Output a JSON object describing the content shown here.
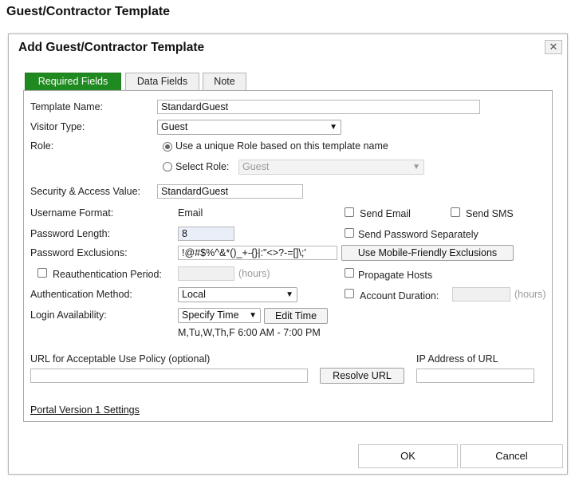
{
  "page": {
    "title": "Guest/Contractor Template"
  },
  "dialog": {
    "title": "Add Guest/Contractor Template",
    "close_glyph": "✕"
  },
  "tabs": [
    {
      "label": "Required Fields",
      "active": true
    },
    {
      "label": "Data Fields",
      "active": false
    },
    {
      "label": "Note",
      "active": false
    }
  ],
  "form": {
    "template_name": {
      "label": "Template Name:",
      "value": "StandardGuest"
    },
    "visitor_type": {
      "label": "Visitor Type:",
      "value": "Guest"
    },
    "role": {
      "label": "Role:",
      "option_unique": "Use a unique Role based on this template name",
      "option_select": "Select Role:",
      "select_value": "Guest",
      "selected": "unique"
    },
    "security_access": {
      "label": "Security & Access Value:",
      "value": "StandardGuest"
    },
    "username_format": {
      "label": "Username Format:",
      "value": "Email"
    },
    "password_length": {
      "label": "Password Length:",
      "value": "8"
    },
    "password_exclusions": {
      "label": "Password Exclusions:",
      "value": "!@#$%^&*()_+-{}|:\"<>?-=[]\\;'"
    },
    "reauthentication": {
      "label": "Reauthentication Period:",
      "value": "",
      "unit": "(hours)",
      "checked": false
    },
    "auth_method": {
      "label": "Authentication Method:",
      "value": "Local"
    },
    "login_availability": {
      "label": "Login Availability:",
      "value": "Specify Time",
      "edit_label": "Edit Time",
      "schedule": "M,Tu,W,Th,F 6:00 AM - 7:00 PM"
    },
    "send_email": {
      "label": "Send Email",
      "checked": false
    },
    "send_sms": {
      "label": "Send SMS",
      "checked": false
    },
    "send_password_separately": {
      "label": "Send Password Separately",
      "checked": false
    },
    "mobile_exclusions": {
      "label": "Use Mobile-Friendly Exclusions"
    },
    "propagate_hosts": {
      "label": "Propagate Hosts",
      "checked": false
    },
    "account_duration": {
      "label": "Account Duration:",
      "value": "",
      "unit": "(hours)",
      "checked": false
    },
    "aup_url": {
      "label": "URL for Acceptable Use Policy (optional)",
      "value": "",
      "resolve_label": "Resolve URL"
    },
    "ip_address": {
      "label": "IP Address of URL",
      "value": ""
    },
    "portal_link": "Portal Version 1 Settings"
  },
  "footer": {
    "ok": "OK",
    "cancel": "Cancel"
  },
  "colors": {
    "tab_active": "#1f8a1f"
  }
}
